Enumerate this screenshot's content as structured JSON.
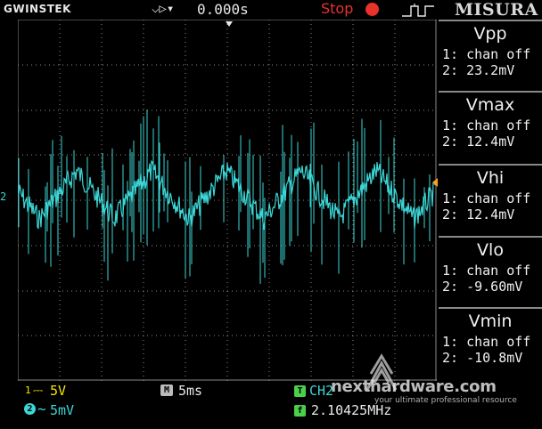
{
  "topbar": {
    "brand": "GWINSTEK",
    "trigger_arrows": "⌵▷▾",
    "time_offset": "0.000s",
    "run_status": "Stop",
    "logo": "MISURA"
  },
  "screen": {
    "ch2_marker": "2",
    "trace_color": "#3cd6d6",
    "grid_color": "#8a8a8a"
  },
  "measurements": [
    {
      "title": "Vpp",
      "ch1": "1: chan off",
      "ch2": "2: 23.2mV"
    },
    {
      "title": "Vmax",
      "ch1": "1: chan off",
      "ch2": "2: 12.4mV"
    },
    {
      "title": "Vhi",
      "ch1": "1: chan off",
      "ch2": "2: 12.4mV"
    },
    {
      "title": "Vlo",
      "ch1": "1: chan off",
      "ch2": "2: -9.60mV"
    },
    {
      "title": "Vmin",
      "ch1": "1: chan off",
      "ch2": "2: -10.8mV"
    }
  ],
  "bottombar": {
    "ch1_number": "1",
    "ch1_coupling": "⎓",
    "ch1_scale": "5V",
    "ch2_number": "2",
    "ch2_coupling": "~",
    "ch2_scale": "5mV",
    "timebase_icon": "M",
    "timebase": "5ms",
    "trigger_icon": "T",
    "trigger_source": "CH2",
    "frequency_icon": "f",
    "frequency": "2.10425MHz"
  },
  "watermark": {
    "text": "nexthardware.com",
    "tagline": "your ultimate professional resource"
  },
  "colors": {
    "ch1": "#f6e600",
    "ch2": "#3cd6d6",
    "stop": "#e8322a",
    "trigger_marker": "#ff9e1a"
  }
}
